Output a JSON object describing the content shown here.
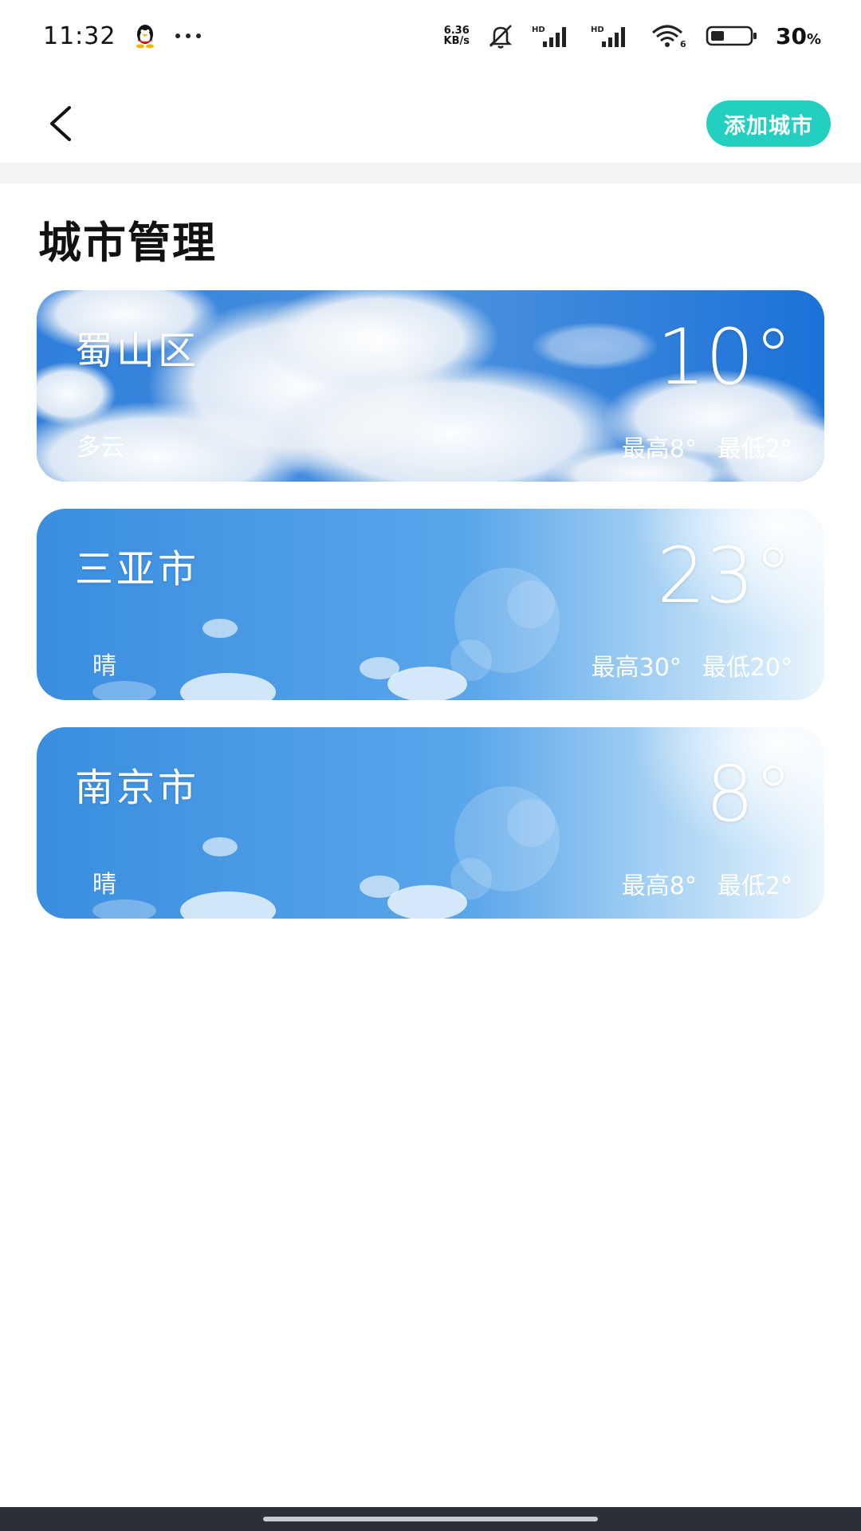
{
  "status_bar": {
    "time": "11:32",
    "net_speed_value": "6.36",
    "net_speed_unit": "KB/s",
    "battery_percent": "30",
    "battery_symbol": "%",
    "hd_label": "HD"
  },
  "header": {
    "add_city_label": "添加城市"
  },
  "page_title": "城市管理",
  "cities": [
    {
      "name": "蜀山区",
      "temp": "10°",
      "condition": "多云",
      "high": "最高8°",
      "low": "最低2°",
      "background": "cloudy"
    },
    {
      "name": "三亚市",
      "temp": "23°",
      "condition": "晴",
      "high": "最高30°",
      "low": "最低20°",
      "background": "sunny"
    },
    {
      "name": "南京市",
      "temp": "8°",
      "condition": "晴",
      "high": "最高8°",
      "low": "最低2°",
      "background": "sunny"
    }
  ],
  "colors": {
    "accent": "#22cfc1",
    "card_sky": "#3f8fe0",
    "nav_bar": "#2b2f37"
  }
}
